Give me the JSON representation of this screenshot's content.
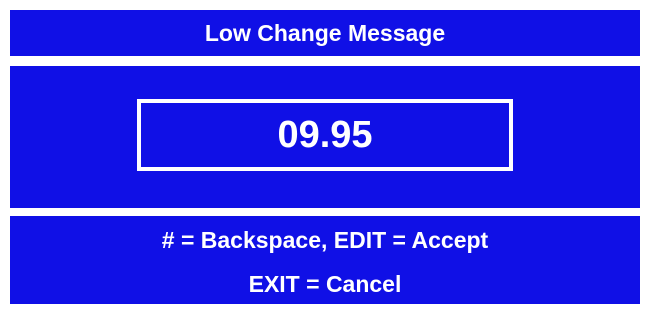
{
  "dialog": {
    "title": "Low Change Message",
    "value": "09.95",
    "help": {
      "line1": "# = Backspace, EDIT = Accept",
      "line2": "EXIT = Cancel"
    }
  },
  "colors": {
    "panel_background": "#1010e6",
    "text": "#ffffff",
    "page_background": "#ffffff"
  }
}
